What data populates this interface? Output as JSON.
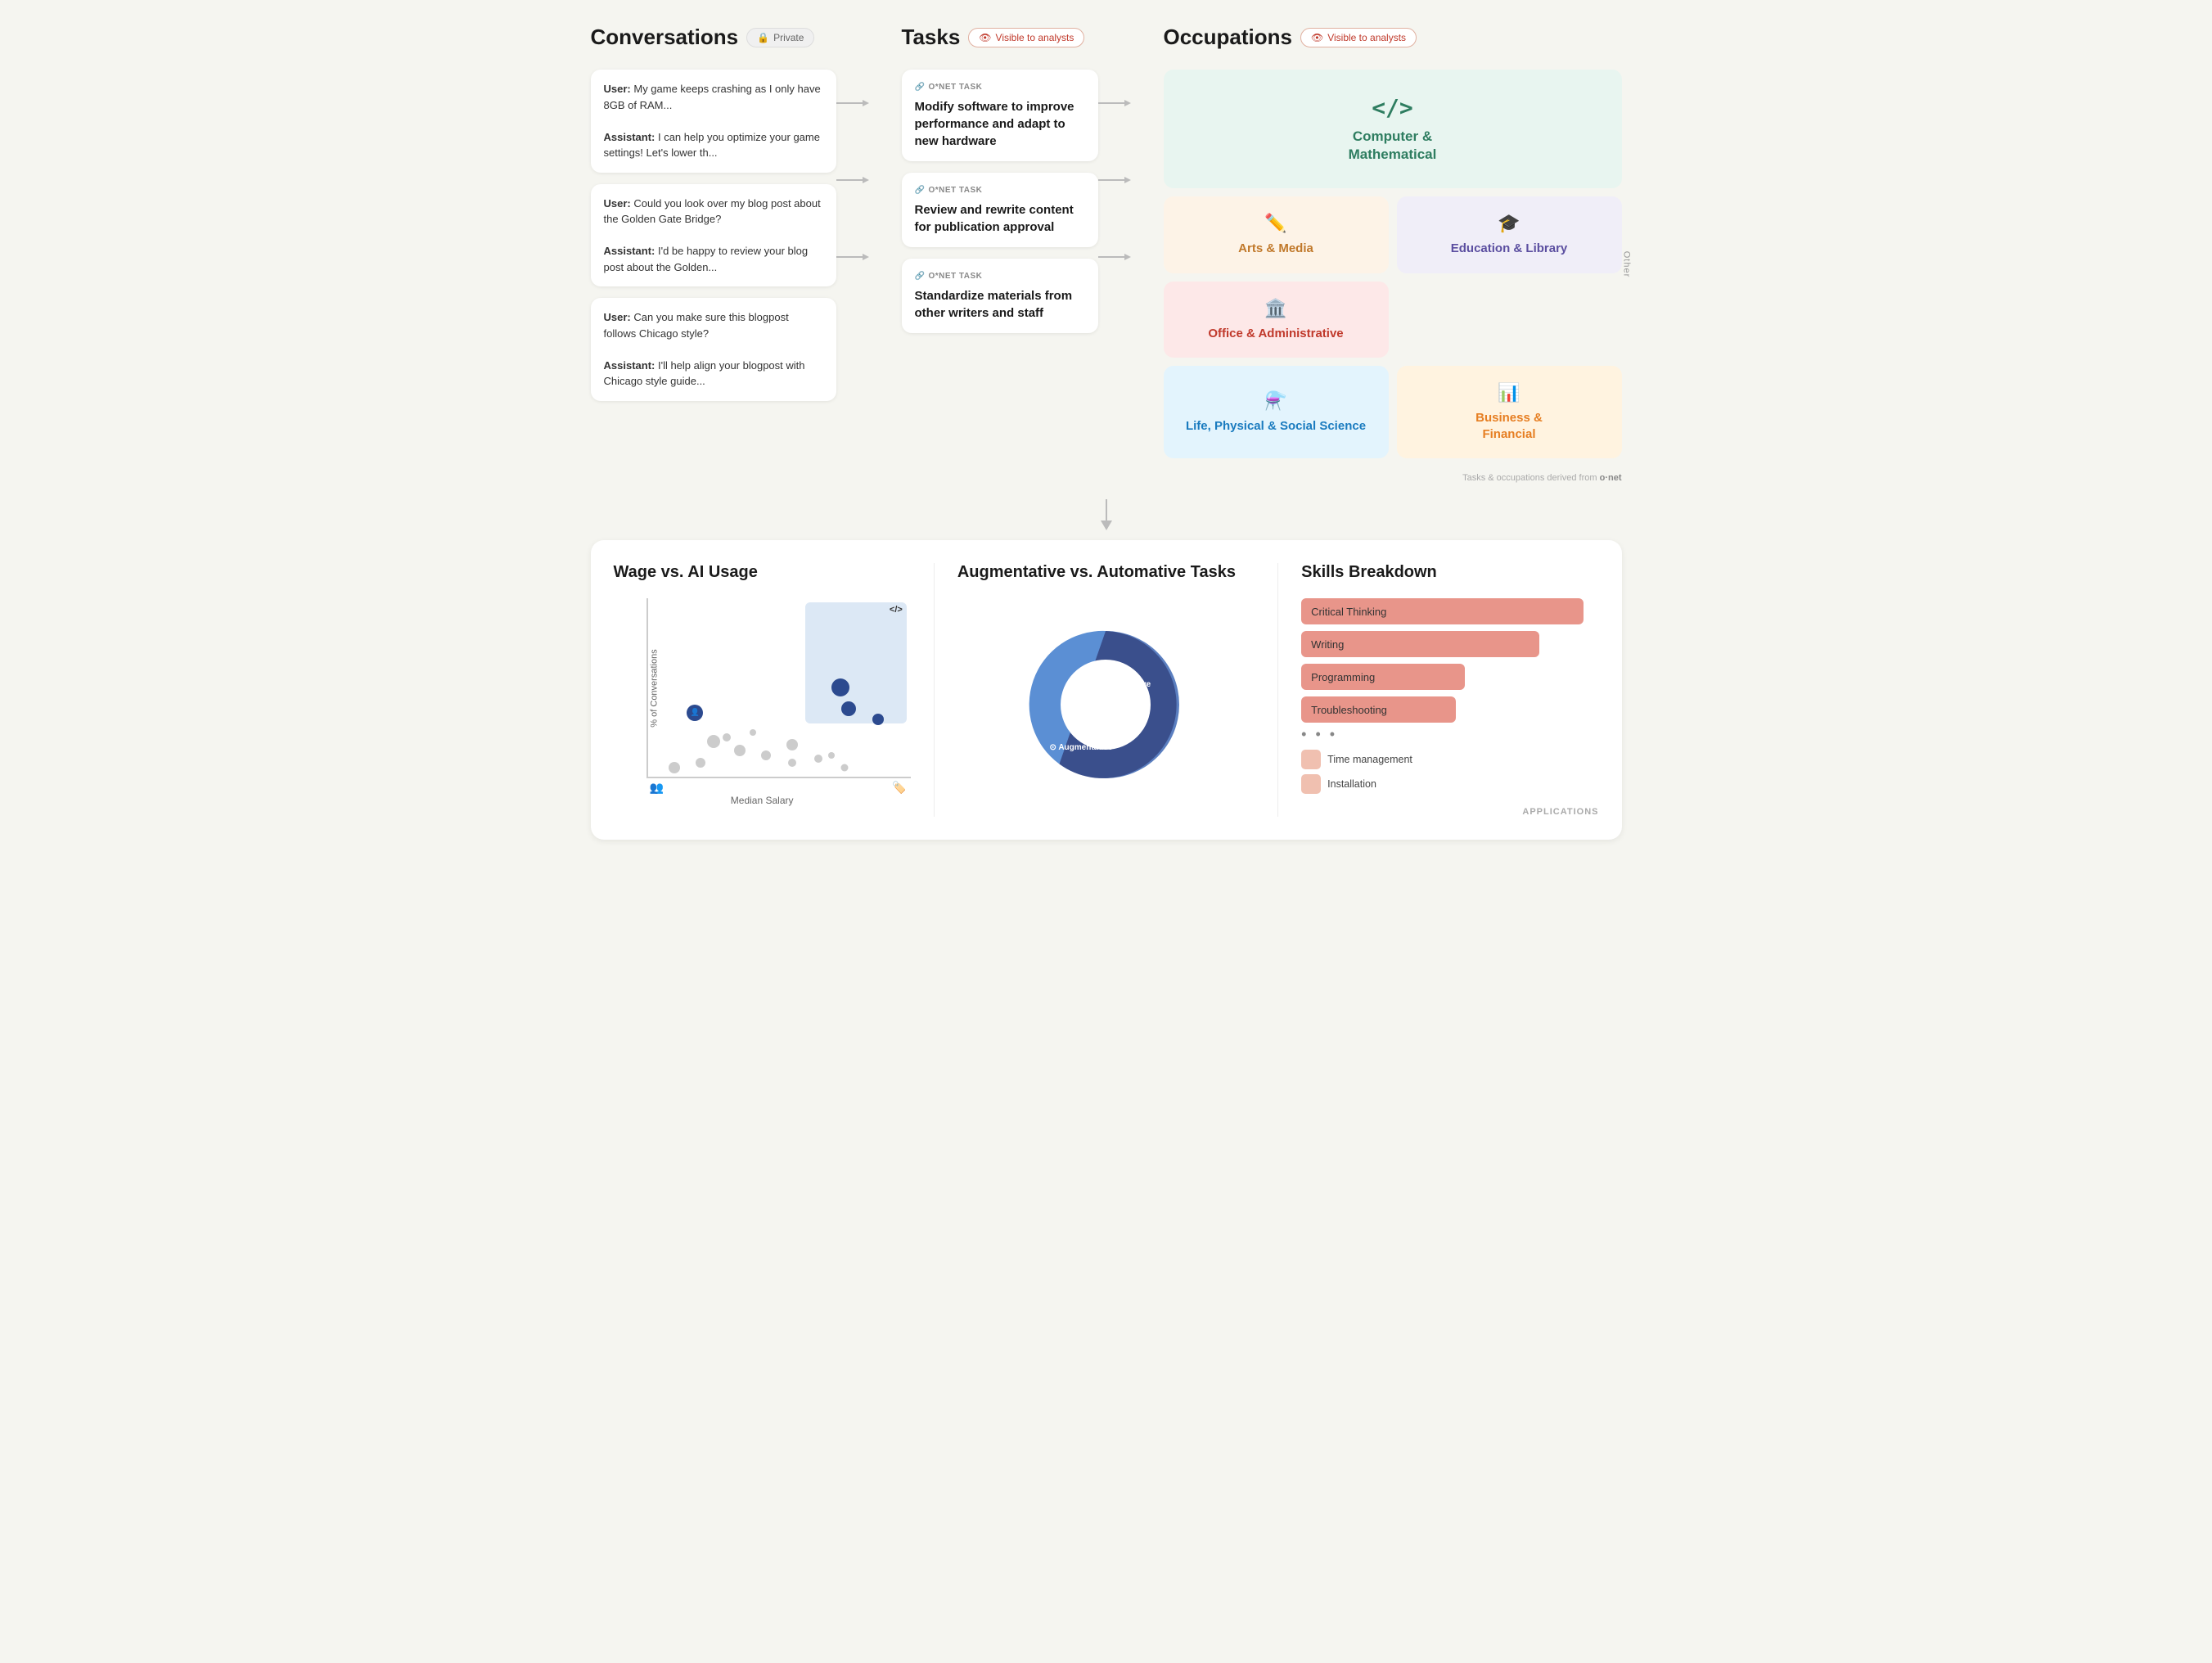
{
  "conversations": {
    "title": "Conversations",
    "badge": "Private",
    "items": [
      {
        "user_text": "My game keeps crashing as I only have 8GB of RAM...",
        "assistant_text": "I can help you optimize your game settings! Let's lower th..."
      },
      {
        "user_text": "Could you look over my blog post about the Golden Gate Bridge?",
        "assistant_text": "I'd be happy to review your blog post about the Golden..."
      },
      {
        "user_text": "Can you make sure this blogpost follows Chicago style?",
        "assistant_text": "I'll help align your blogpost with Chicago style guide..."
      }
    ]
  },
  "tasks": {
    "title": "Tasks",
    "badge": "Visible to analysts",
    "items": [
      {
        "label": "O*NET TASK",
        "text": "Modify software to improve performance and adapt to new hardware"
      },
      {
        "label": "O*NET TASK",
        "text": "Review and rewrite content for publication approval"
      },
      {
        "label": "O*NET TASK",
        "text": "Standardize materials from other writers and staff"
      }
    ]
  },
  "occupations": {
    "title": "Occupations",
    "badge": "Visible to analysts",
    "items": [
      {
        "name": "Computer &\nMathematical",
        "category": "computer",
        "icon": "</>",
        "bg": "#e8f5f0",
        "color": "#2e7d60"
      },
      {
        "name": "Arts & Media",
        "category": "arts",
        "icon": "✏",
        "bg": "#fdf3e7",
        "color": "#c0782a"
      },
      {
        "name": "Education & Library",
        "category": "education",
        "icon": "🎓",
        "bg": "#f0eef8",
        "color": "#5b4ea0"
      },
      {
        "name": "Office & Administrative",
        "category": "office",
        "icon": "🏛",
        "bg": "#fde8e8",
        "color": "#c0392b"
      },
      {
        "name": "Business &\nFinancial",
        "category": "business",
        "icon": "📊",
        "bg": "#fff3e0",
        "color": "#e67e22"
      },
      {
        "name": "Life, Physical & Social Science",
        "category": "science",
        "icon": "⚗",
        "bg": "#e3f4fd",
        "color": "#1a7bbf"
      }
    ],
    "onet_note": "Tasks & occupations derived from",
    "onet_brand": "o·net"
  },
  "wage_chart": {
    "title": "Wage vs. AI Usage",
    "x_label": "Median Salary",
    "y_label": "% of Conversations",
    "code_label": "</>"
  },
  "donut_chart": {
    "title": "Augmentative vs.\nAutomative Tasks",
    "automative_label": "Automative",
    "augmentative_label": "Augmentative",
    "automative_pct": 55,
    "augmentative_pct": 45
  },
  "skills": {
    "title": "Skills Breakdown",
    "bars": [
      {
        "name": "Critical Thinking",
        "width": 95
      },
      {
        "name": "Writing",
        "width": 80
      },
      {
        "name": "Programming",
        "width": 55
      },
      {
        "name": "Troubleshooting",
        "width": 50
      }
    ],
    "legend": [
      {
        "name": "Time management"
      },
      {
        "name": "Installation"
      }
    ],
    "footer": "APPLICATIONS"
  }
}
